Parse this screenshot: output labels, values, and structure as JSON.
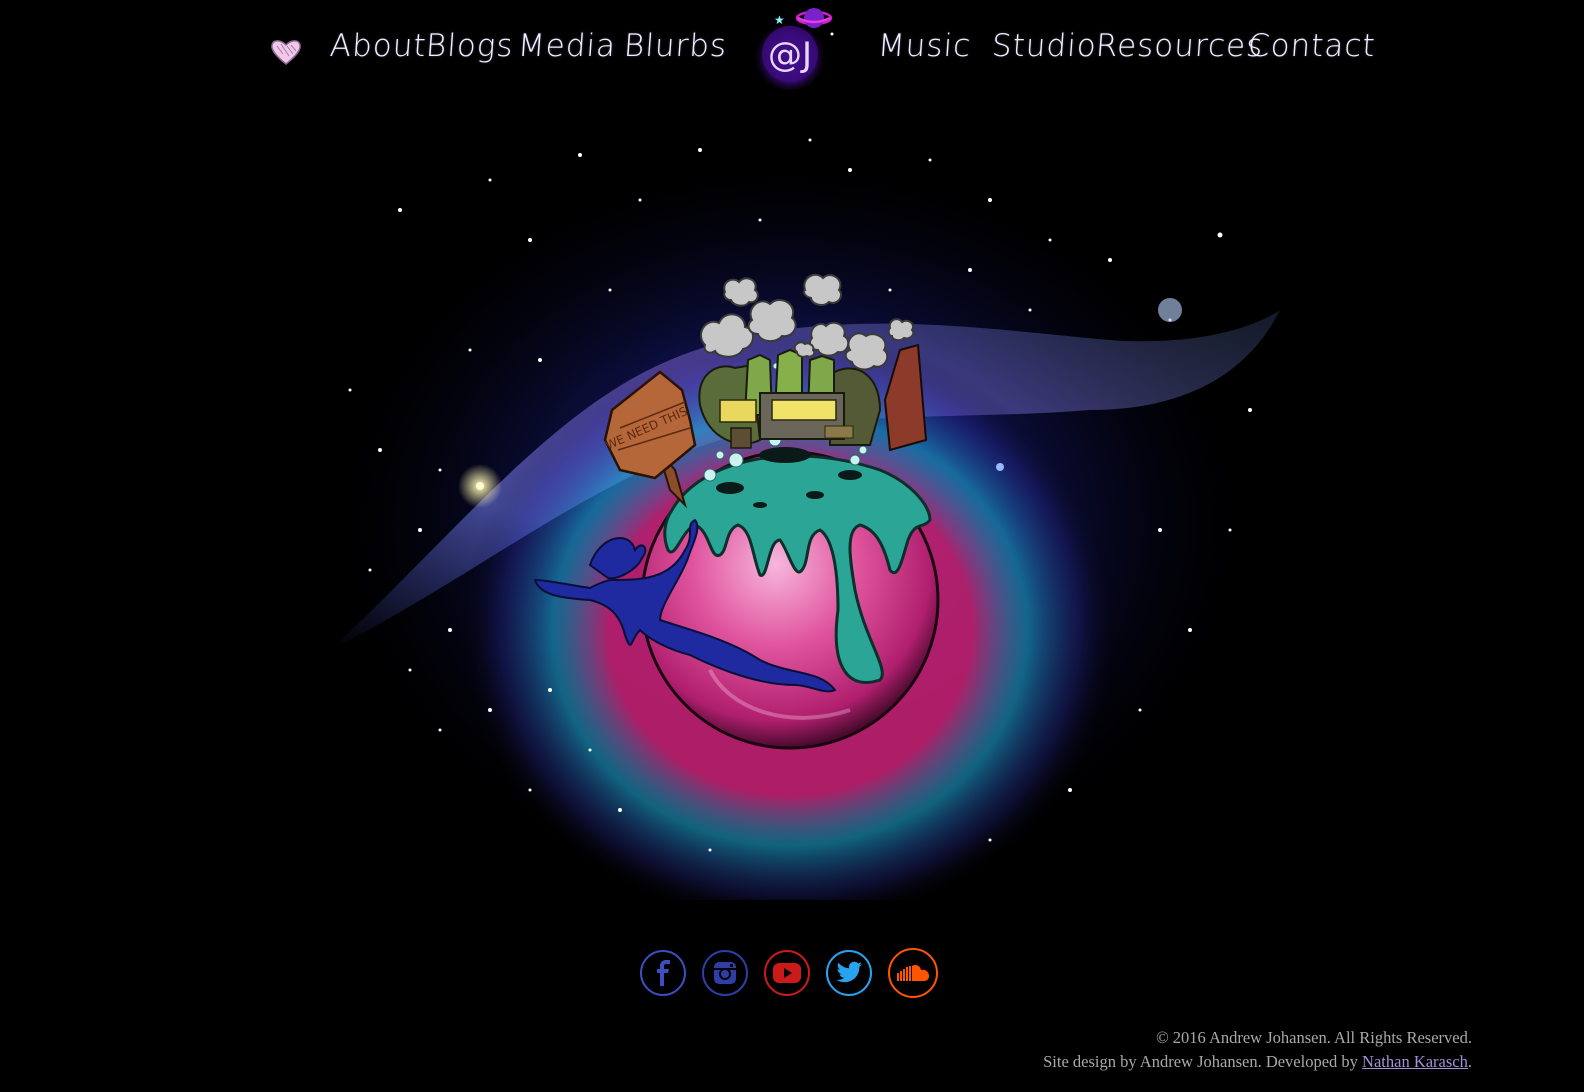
{
  "nav": {
    "left_items": [
      {
        "label": "About"
      },
      {
        "label": "Blogs"
      },
      {
        "label": "Media"
      },
      {
        "label": "Blurbs"
      }
    ],
    "right_items": [
      {
        "label": "Music"
      },
      {
        "label": "Studio"
      },
      {
        "label": "Resources"
      },
      {
        "label": "Contact"
      }
    ],
    "heart_icon": "heart-icon",
    "logo_text": "@J",
    "logo_icon": "planet-logo-icon"
  },
  "hero": {
    "sign_text": "WE NEED THIS",
    "illustration": "planet-illustration"
  },
  "social": [
    {
      "name": "facebook",
      "icon": "facebook-icon",
      "color": "#3b4fc2"
    },
    {
      "name": "instagram",
      "icon": "instagram-icon",
      "color": "#2d3fa6"
    },
    {
      "name": "youtube",
      "icon": "youtube-icon",
      "color": "#cc1a1a"
    },
    {
      "name": "twitter",
      "icon": "twitter-icon",
      "color": "#2aa3ef"
    },
    {
      "name": "soundcloud",
      "icon": "soundcloud-icon",
      "color": "#ff5500"
    }
  ],
  "footer": {
    "copyright": "© 2016 Andrew Johansen. All Rights Reserved.",
    "credits_prefix": "Site design by Andrew Johansen. Developed by ",
    "developer_link": "Nathan Karasch",
    "credits_suffix": "."
  },
  "colors": {
    "background": "#000000",
    "nav_text": "#f4f0ff",
    "footer_text": "#a8a8a8",
    "link": "#a690d8",
    "planet_pink": "#e0549e",
    "slime_teal": "#2aa596"
  }
}
